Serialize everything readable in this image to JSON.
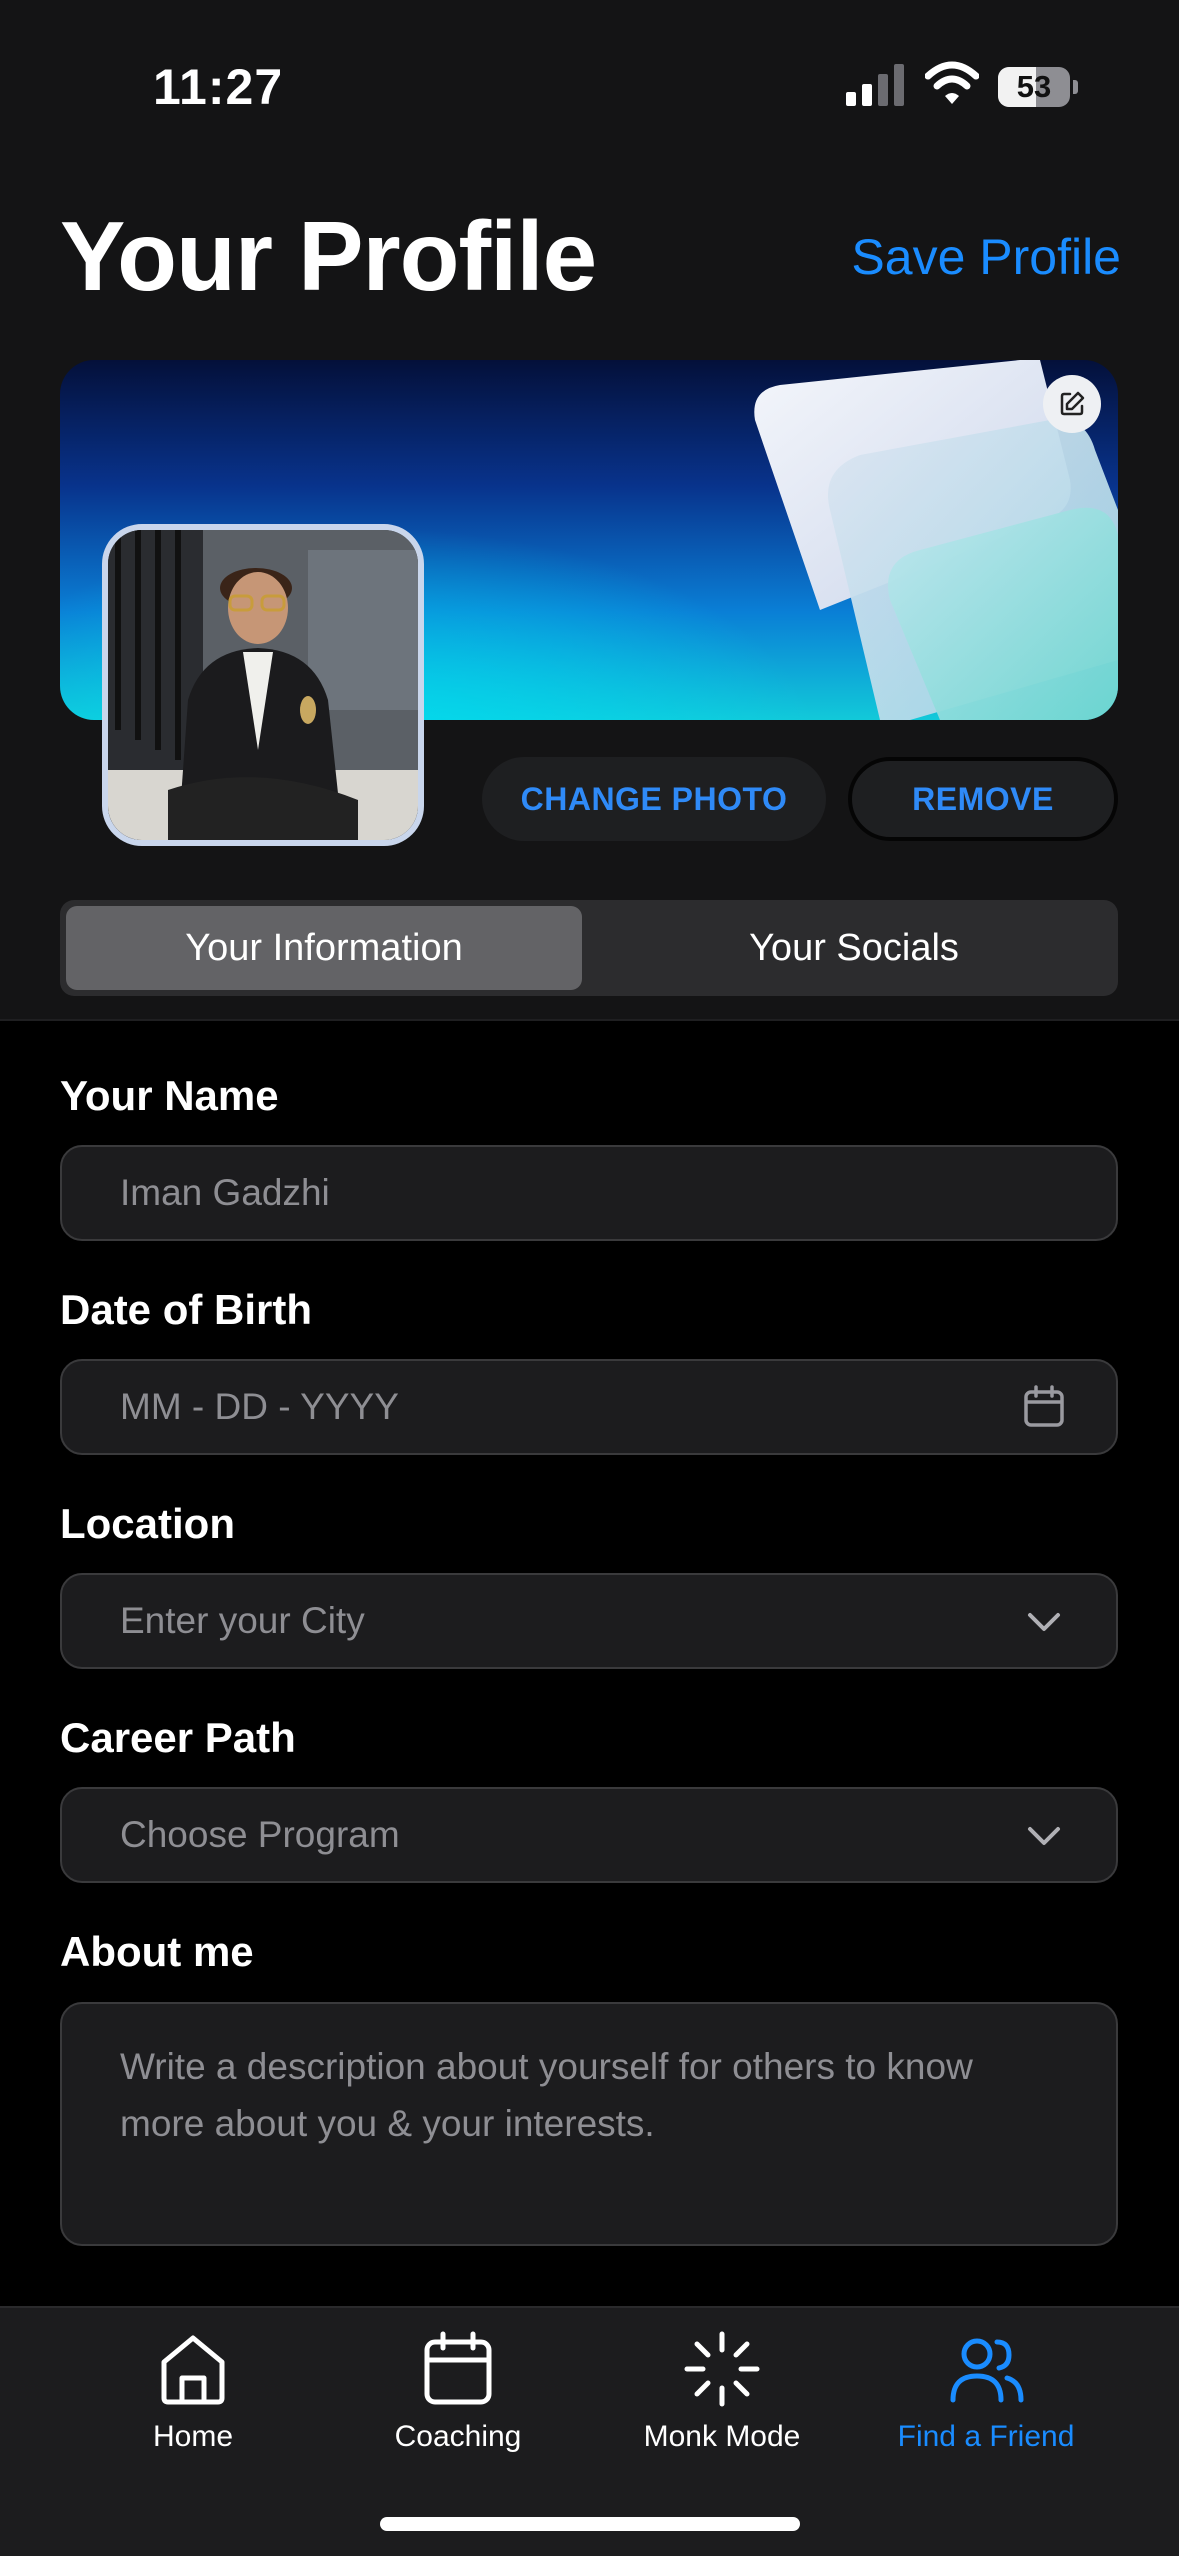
{
  "status_bar": {
    "time": "11:27",
    "battery": "53",
    "battery_level": 0.53
  },
  "header": {
    "title": "Your Profile",
    "save_label": "Save Profile"
  },
  "photo": {
    "change_label": "CHANGE PHOTO",
    "remove_label": "REMOVE"
  },
  "segments": {
    "info_label": "Your Information",
    "socials_label": "Your Socials",
    "selected": "Your Information"
  },
  "form": {
    "name": {
      "label": "Your Name",
      "value": "Iman Gadzhi"
    },
    "dob": {
      "label": "Date of Birth",
      "placeholder": "MM - DD - YYYY"
    },
    "location": {
      "label": "Location",
      "placeholder": "Enter your City"
    },
    "career": {
      "label": "Career Path",
      "placeholder": "Choose Program"
    },
    "about": {
      "label": "About me",
      "placeholder": "Write a description about yourself for others to know more about you & your interests."
    }
  },
  "tabs": [
    {
      "label": "Home",
      "icon": "home-icon",
      "active": false
    },
    {
      "label": "Coaching",
      "icon": "calendar-icon",
      "active": false
    },
    {
      "label": "Monk Mode",
      "icon": "spinner-icon",
      "active": false
    },
    {
      "label": "Find a Friend",
      "icon": "people-icon",
      "active": true
    }
  ],
  "colors": {
    "accent": "#1a8cff",
    "background": "#000000",
    "field_bg": "#1c1c1e"
  }
}
